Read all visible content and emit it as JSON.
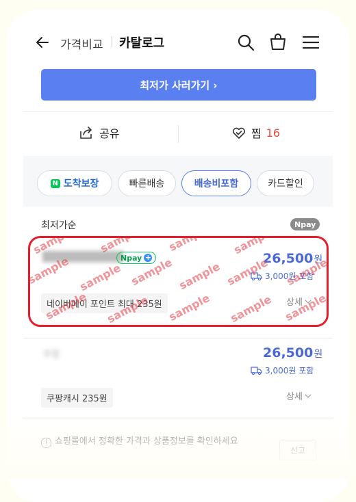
{
  "header": {
    "breadcrumb_parent": "가격비교",
    "breadcrumb_current": "카탈로그",
    "icons": [
      "back-arrow-icon",
      "search-icon",
      "shopping-bag-icon",
      "menu-icon"
    ]
  },
  "cta": {
    "label": "최저가 사러가기 ›"
  },
  "actions": {
    "share_label": "공유",
    "like_label": "찜",
    "like_count": "16"
  },
  "filters": [
    {
      "label": "도착보장",
      "badge": "N",
      "active": false
    },
    {
      "label": "빠른배송",
      "active": false
    },
    {
      "label": "배송비포함",
      "active": true
    },
    {
      "label": "카드할인",
      "active": false
    }
  ],
  "offers_section": {
    "sort_label": "최저가순",
    "npay_badge": "Npay"
  },
  "offers": [
    {
      "seller": "███████████",
      "npay_tag": "Npay",
      "price": "26,500",
      "price_unit": "원",
      "shipping": "3,000원 포함",
      "benefit": "네이버페이 포인트 최대 235원",
      "detail_label": "상세"
    },
    {
      "seller": "쿠팡",
      "price": "26,500",
      "price_unit": "원",
      "shipping": "3,000원 포함",
      "benefit": "쿠팡캐시 235원",
      "detail_label": "상세"
    }
  ],
  "watermark": "sample",
  "footer": {
    "notice": "쇼핑몰에서 정확한 가격과 상품정보를 확인하세요",
    "report_label": "신고"
  },
  "colors": {
    "accent": "#5a7ff0",
    "price": "#4a69d6",
    "like": "#e4463c",
    "highlight": "#e61e2b",
    "npay_green": "#03c75a"
  }
}
